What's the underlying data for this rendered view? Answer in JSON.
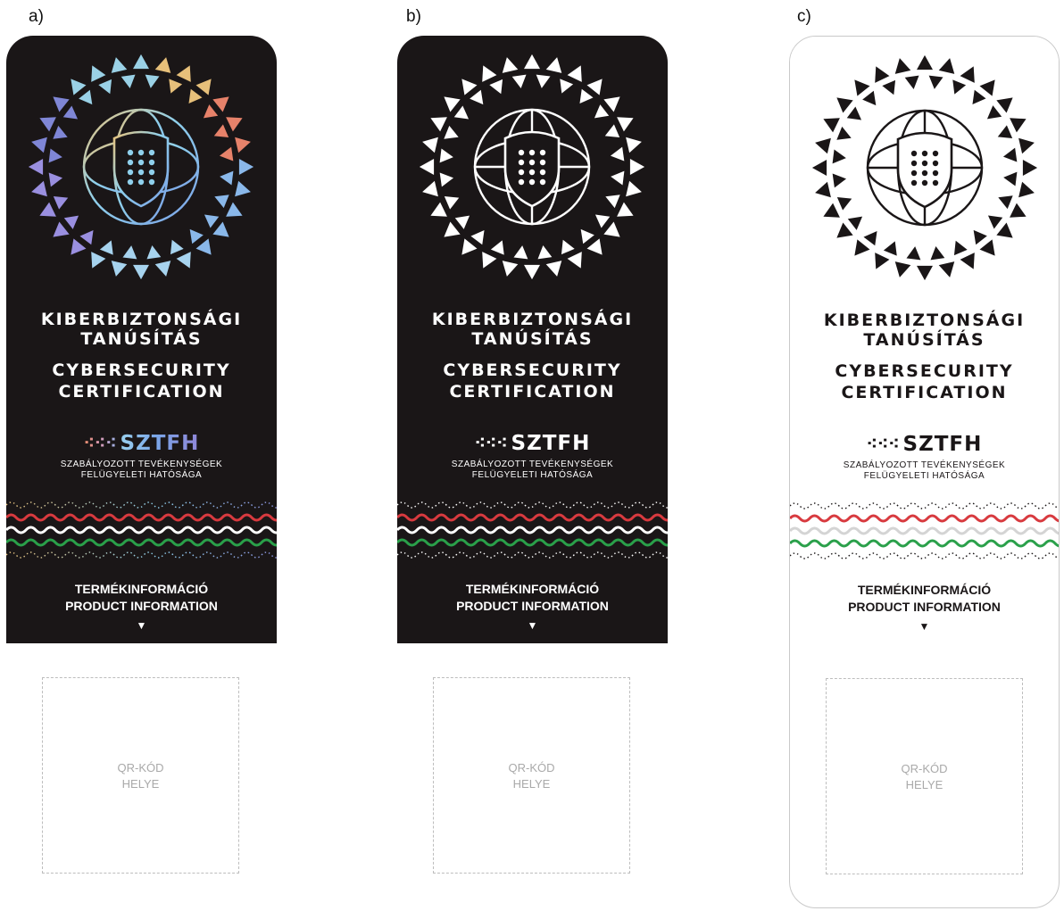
{
  "variants": [
    {
      "letter": "a)",
      "style": "holographic"
    },
    {
      "letter": "b)",
      "style": "white-on-black"
    },
    {
      "letter": "c)",
      "style": "black-on-white"
    }
  ],
  "label": {
    "title_hu_1": "KIBERBIZTONSÁGI",
    "title_hu_2": "TANÚSÍTÁS",
    "title_en_1": "CYBERSECURITY",
    "title_en_2": "CERTIFICATION",
    "brand_dots": "⁖⁖⁖",
    "brand": "SZTFH",
    "authority_1": "SZABÁLYOZOTT TEVÉKENYSÉGEK",
    "authority_2": "FELÜGYELETI HATÓSÁGA",
    "product_info_hu": "TERMÉKINFORMÁCIÓ",
    "product_info_en": "PRODUCT INFORMATION",
    "arrow": "▼",
    "qr_line_1": "QR-KÓD",
    "qr_line_2": "HELYE"
  },
  "colors": {
    "dark_bg": "#1a1617",
    "flag_red": "#d83a3f",
    "flag_white": "#ffffff",
    "flag_green": "#2aa04a",
    "flag_white_on_light": "#d4d4d4",
    "qr_text": "#a9a9a9"
  },
  "icons": [
    "triangle-ring-icon",
    "globe-icon",
    "shield-icon",
    "wave-icon",
    "arrow-down-icon"
  ]
}
